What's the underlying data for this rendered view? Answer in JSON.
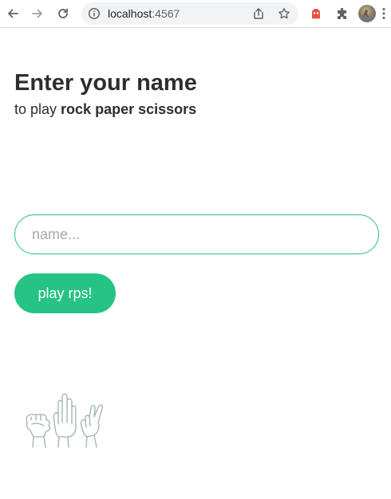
{
  "browser": {
    "url_host": "localhost",
    "url_port": ":4567"
  },
  "page": {
    "title": "Enter your name",
    "subtitle_prefix": "to play ",
    "subtitle_game": "rock paper scissors",
    "name_placeholder": "name...",
    "name_value": "",
    "play_button_label": "play rps!"
  },
  "colors": {
    "accent": "#26c384",
    "input_border": "#26bf84",
    "illustration_stroke": "#9fb3a8"
  },
  "icons": {
    "back": "arrow-left-icon",
    "forward": "arrow-right-icon",
    "reload": "reload-icon",
    "site_info": "info-icon",
    "share": "share-icon",
    "bookmark": "star-icon",
    "extension": "ghost-extension-icon",
    "extensions_menu": "puzzle-icon",
    "profile": "avatar",
    "illustration": "rock-paper-scissors-hands-icon"
  }
}
